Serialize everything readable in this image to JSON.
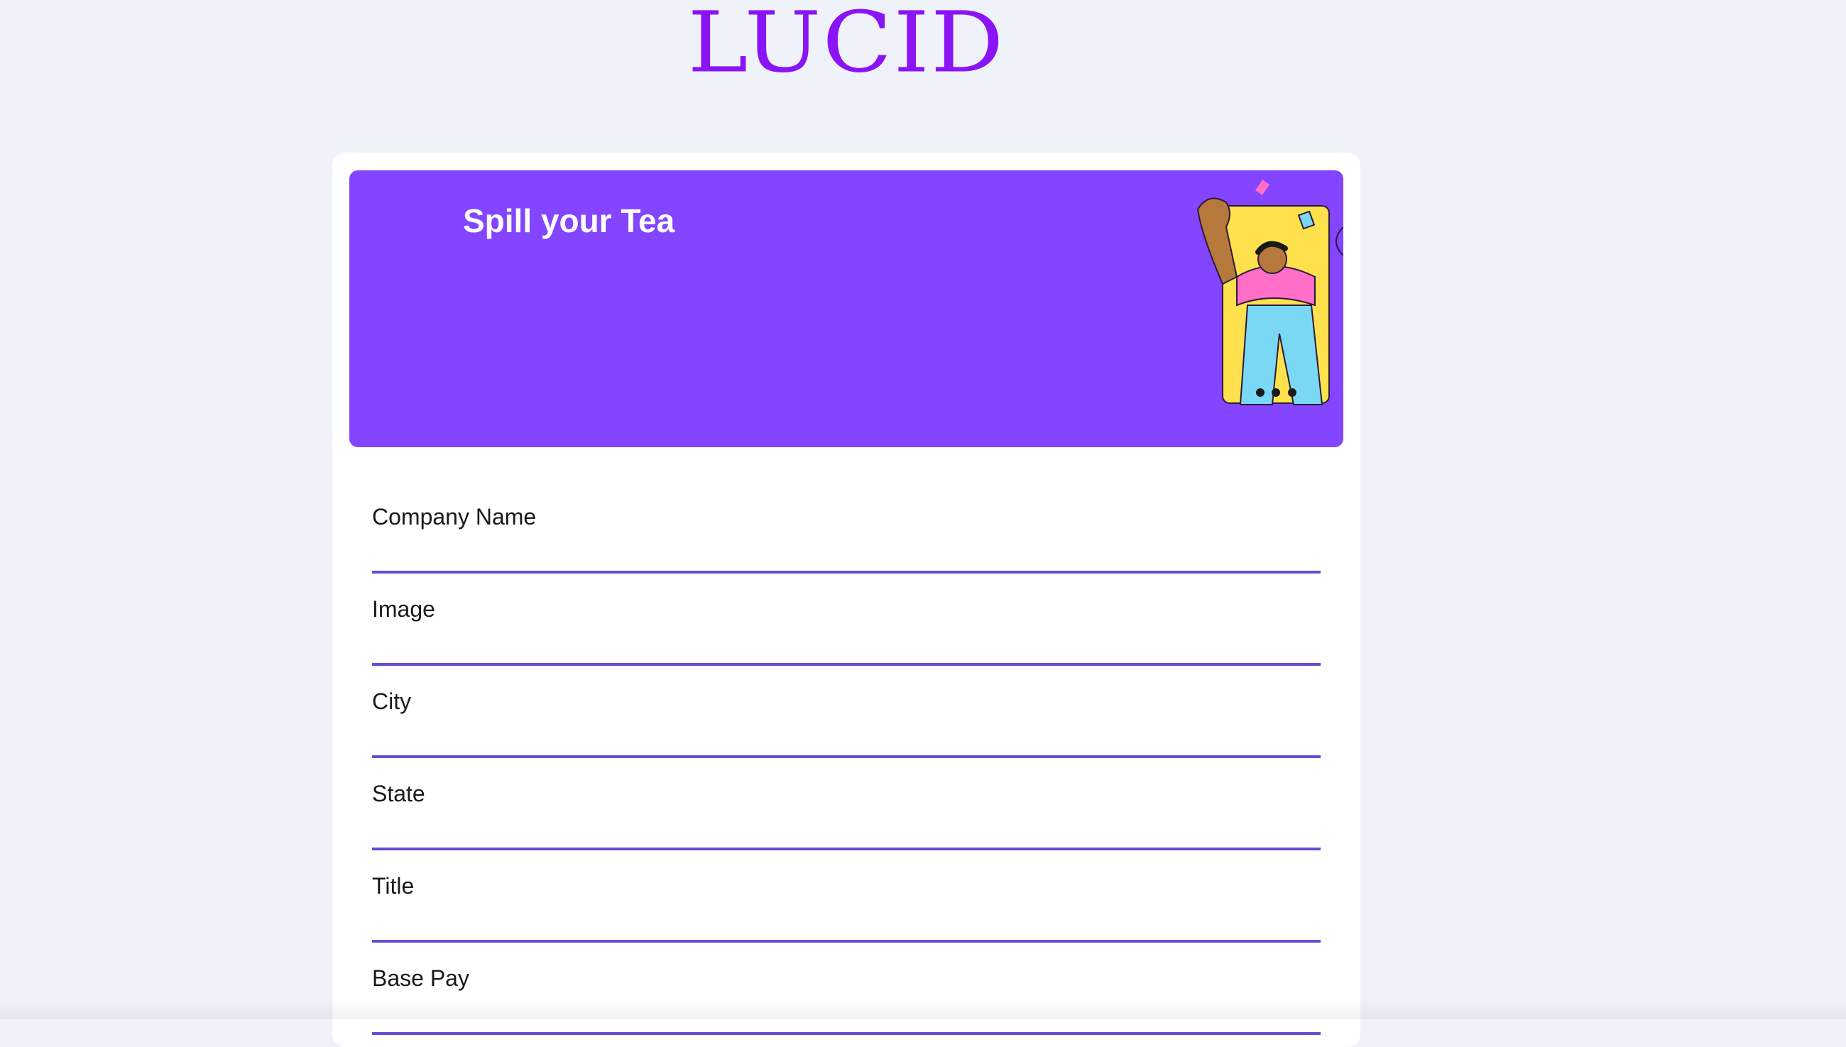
{
  "brand": {
    "logo_text": "LUCID"
  },
  "banner": {
    "title": "Spill your Tea",
    "illustration": "three-people-celebrating-illustration"
  },
  "form": {
    "fields": [
      {
        "label": "Company Name",
        "value": ""
      },
      {
        "label": "Image",
        "value": ""
      },
      {
        "label": "City",
        "value": ""
      },
      {
        "label": "State",
        "value": ""
      },
      {
        "label": "Title",
        "value": ""
      },
      {
        "label": "Base Pay",
        "value": ""
      }
    ]
  },
  "colors": {
    "brand_purple": "#8a14f5",
    "banner_purple": "#8345ff",
    "input_underline": "#6a4bd6",
    "page_background": "#eff2f9"
  }
}
